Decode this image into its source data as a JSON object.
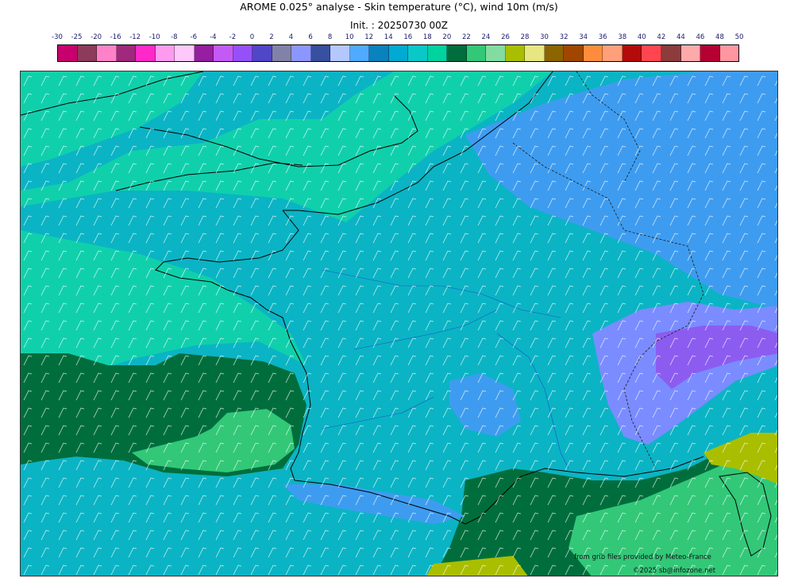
{
  "header": {
    "title": "AROME 0.025° analyse - Skin temperature (°C), wind 10m (m/s)",
    "init": "Init. : 20250730 00Z"
  },
  "colorbar": {
    "ticks": [
      "-30",
      "-25",
      "-20",
      "-16",
      "-12",
      "-10",
      "-8",
      "-6",
      "-4",
      "-2",
      "0",
      "2",
      "4",
      "6",
      "8",
      "10",
      "12",
      "14",
      "16",
      "18",
      "20",
      "22",
      "24",
      "26",
      "28",
      "30",
      "32",
      "34",
      "36",
      "38",
      "40",
      "42",
      "44",
      "46",
      "48",
      "50"
    ],
    "colors": [
      "#c8006e",
      "#8c3c5a",
      "#ff82c8",
      "#a0287d",
      "#ff28c8",
      "#ff9bef",
      "#ffc8fa",
      "#961ea0",
      "#c45af5",
      "#9650fa",
      "#5046c8",
      "#8282a8",
      "#8c96ff",
      "#3750a0",
      "#b4c8ff",
      "#50aaff",
      "#0a82be",
      "#00aad2",
      "#0ac8c8",
      "#00d2a0",
      "#006e3c",
      "#32c878",
      "#82dca0",
      "#aabe00",
      "#e6e682",
      "#8c6400",
      "#a04600",
      "#ff8c3c",
      "#ffa07a",
      "#b40a0a",
      "#ff4650",
      "#8c3c3c",
      "#ffaaaa",
      "#b40032",
      "#ff96a0"
    ]
  },
  "map": {
    "background_color": "#0ab4c4",
    "sea_color": "#10d0ac",
    "warm_color": "#006e3c",
    "cool_color": "#3e9cf0",
    "cold_color": "#7a8cff",
    "alps_color": "#8c5cf0"
  },
  "credits": {
    "source": "from grib files provided by Meteo-France",
    "copyright": "©2025 sb@infozone.net"
  }
}
